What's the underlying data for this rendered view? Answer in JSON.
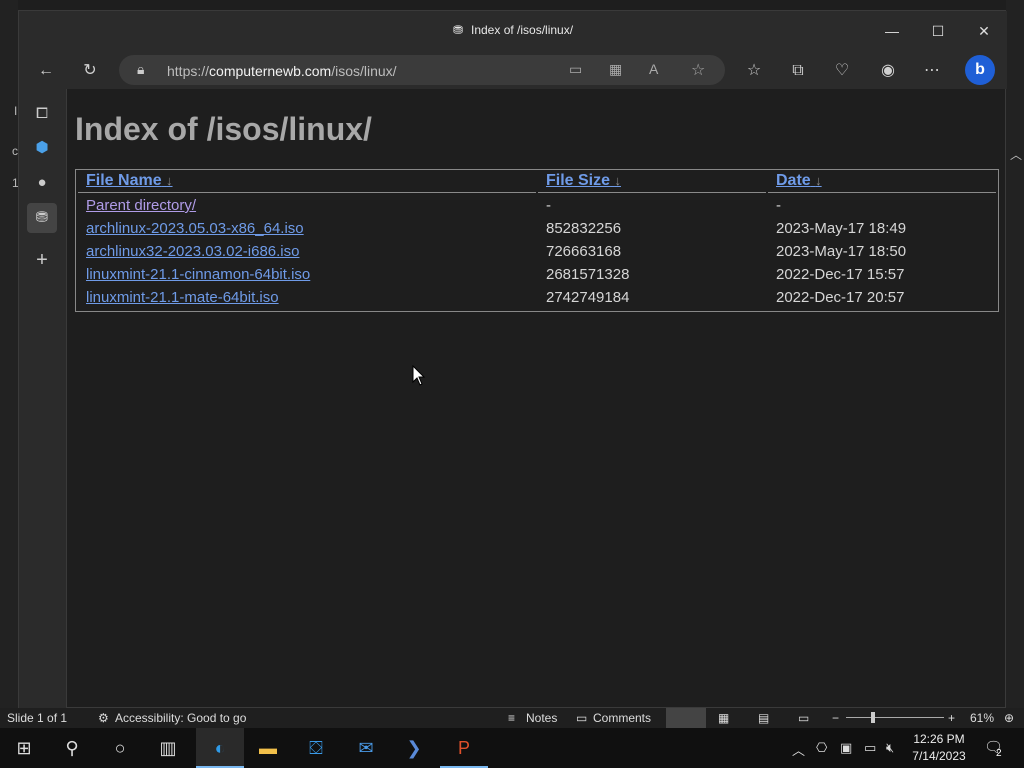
{
  "browser": {
    "title": "Index of /isos/linux/",
    "url_scheme": "https://",
    "url_host": "computernewb.com",
    "url_path": "/isos/linux/"
  },
  "page": {
    "heading": "Index of /isos/linux/",
    "columns": [
      {
        "label": "File Name",
        "sort_icon": "↓"
      },
      {
        "label": "File Size",
        "sort_icon": "↓"
      },
      {
        "label": "Date",
        "sort_icon": "↓"
      }
    ],
    "rows": [
      {
        "name": "Parent directory/",
        "size": "-",
        "date": "-"
      },
      {
        "name": "archlinux-2023.05.03-x86_64.iso",
        "size": "852832256",
        "date": "2023-May-17 18:49"
      },
      {
        "name": "archlinux32-2023.03.02-i686.iso",
        "size": "726663168",
        "date": "2023-May-17 18:50"
      },
      {
        "name": "linuxmint-21.1-cinnamon-64bit.iso",
        "size": "2681571328",
        "date": "2022-Dec-17 15:57"
      },
      {
        "name": "linuxmint-21.1-mate-64bit.iso",
        "size": "2742749184",
        "date": "2022-Dec-17 20:57"
      }
    ]
  },
  "ppt_status": {
    "slide": "Slide 1 of 1",
    "accessibility": "Accessibility: Good to go",
    "notes": "Notes",
    "comments": "Comments",
    "zoom": "61%"
  },
  "bg_chars": {
    "a": "I",
    "b": "c",
    "c": "1"
  },
  "taskbar": {
    "time": "12:26 PM",
    "date": "7/14/2023",
    "notifications": "2"
  }
}
